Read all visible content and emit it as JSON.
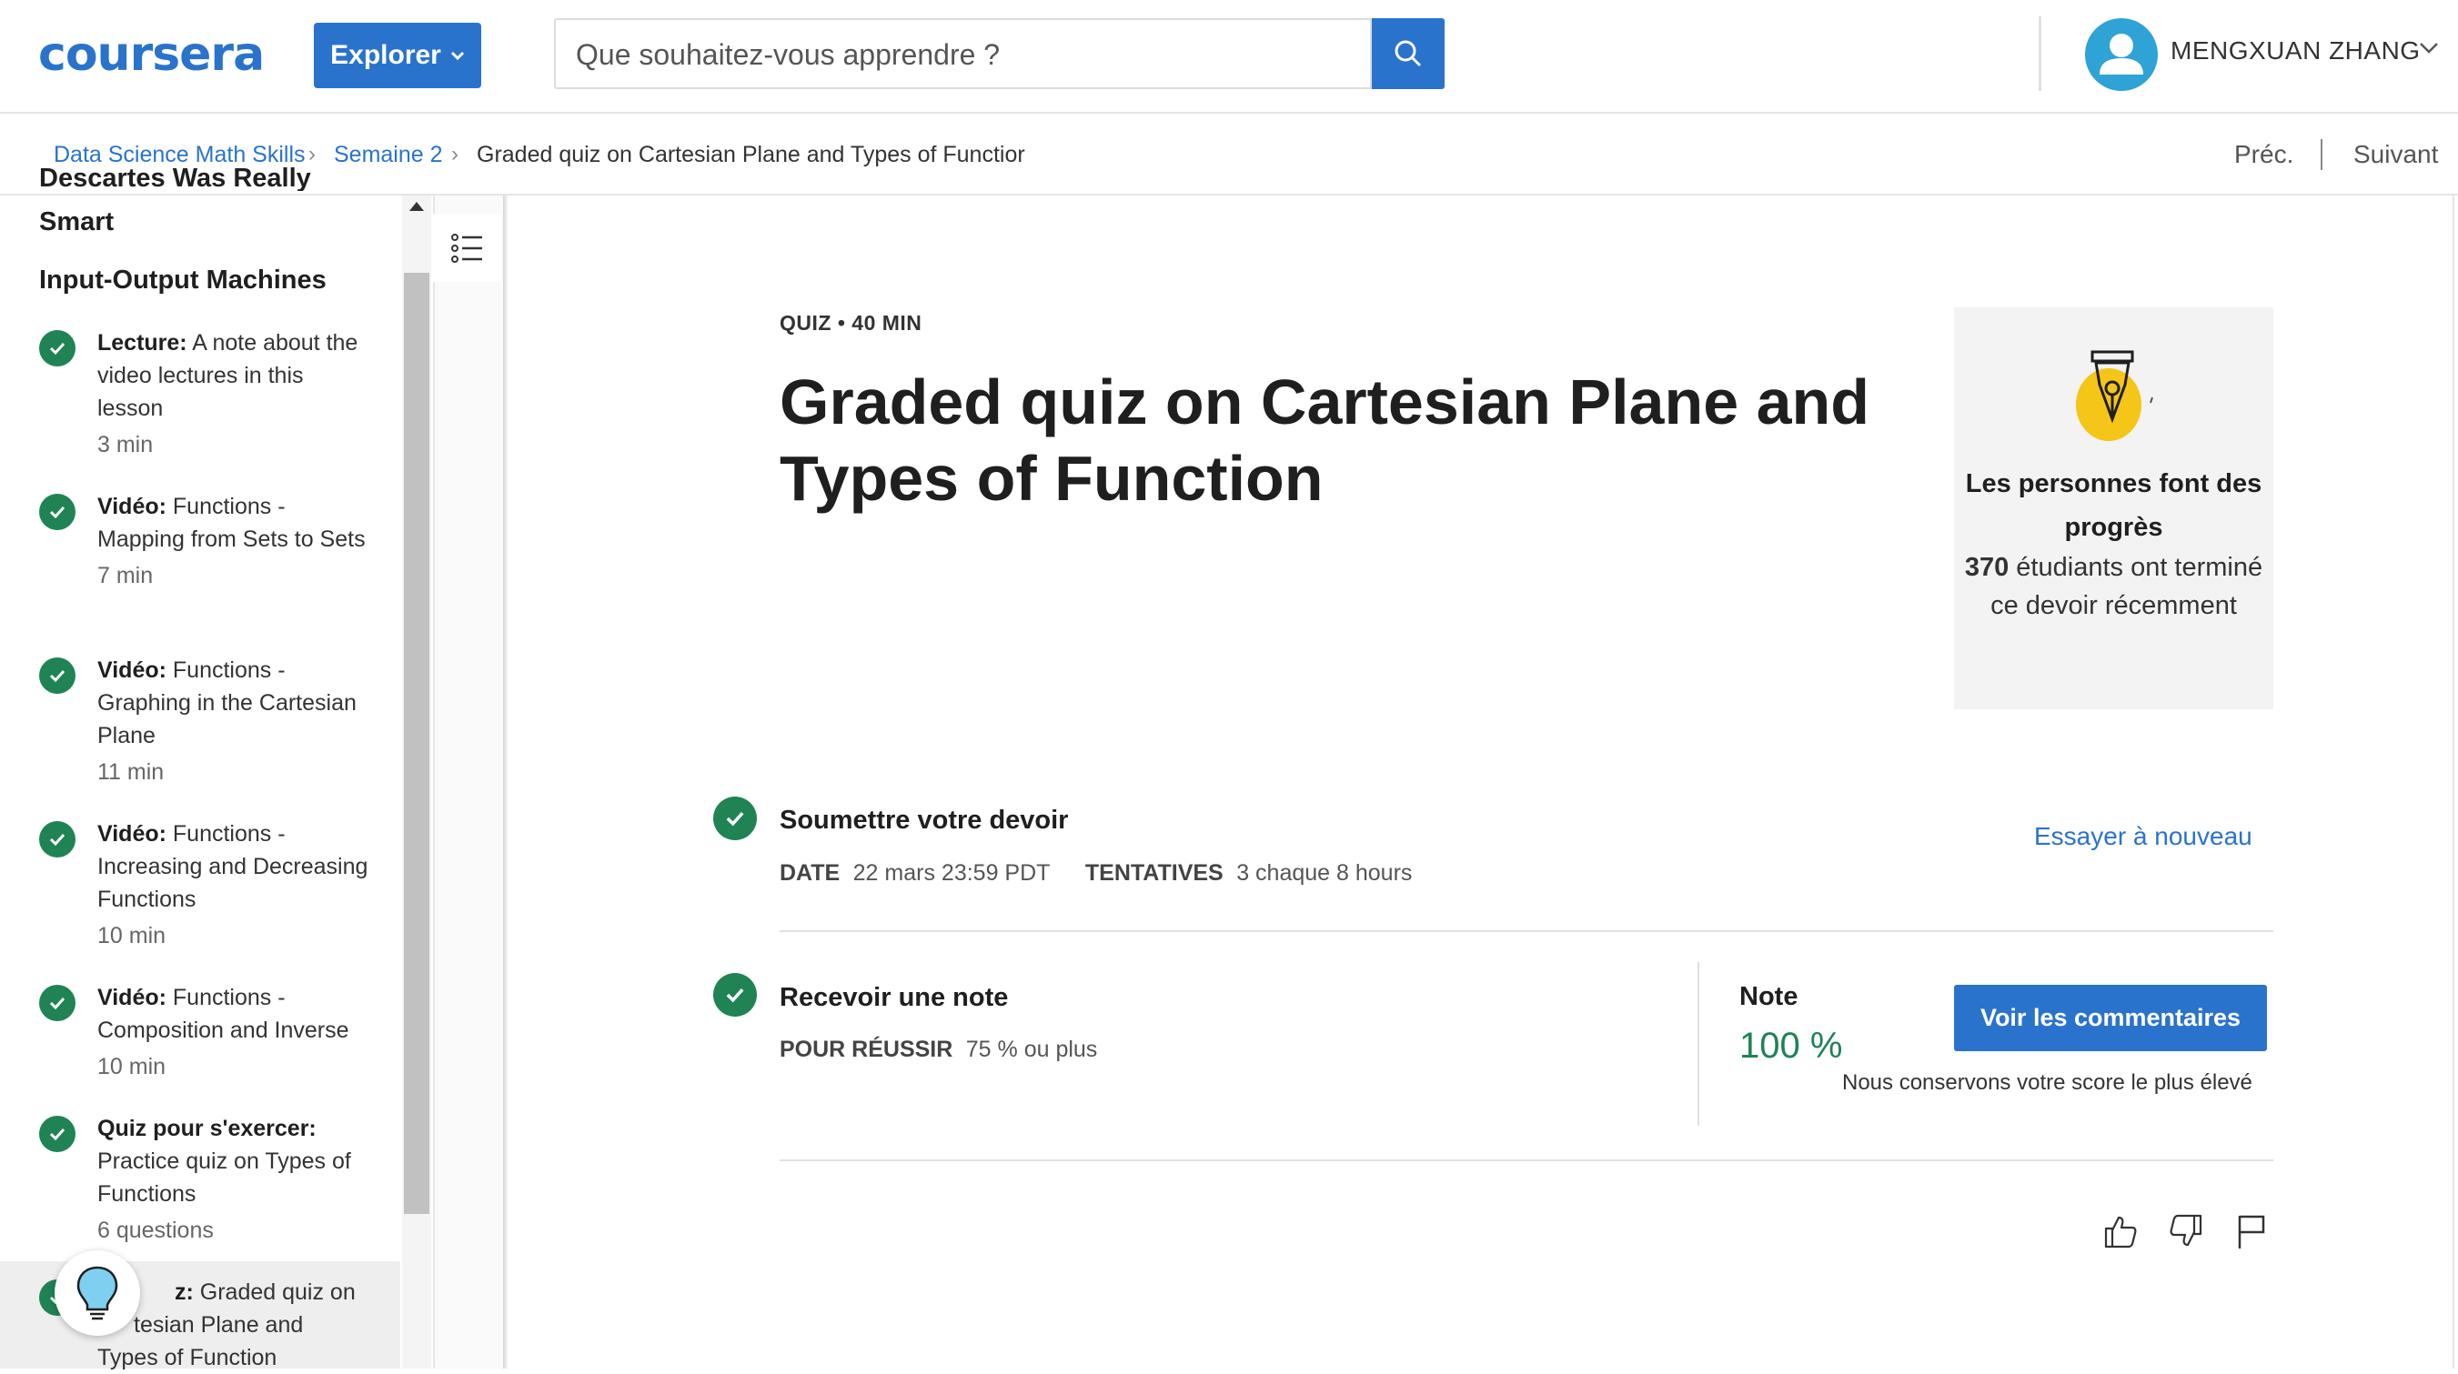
{
  "header": {
    "logo": "coursera",
    "explore_label": "Explorer",
    "search_placeholder": "Que souhaitez-vous apprendre ?",
    "user_name": "MENGXUAN ZHANG"
  },
  "breadcrumb": {
    "items": [
      "Data Science Math Skills",
      "Semaine 2",
      "Graded quiz on Cartesian Plane and Types of Functior"
    ],
    "prev": "Préc.",
    "next": "Suivant"
  },
  "sidebar": {
    "partial_title": "Descartes Was Really",
    "partial_title_2": "Smart",
    "section": "Input-Output Machines",
    "items": [
      {
        "type": "Lecture:",
        "title": "A note about the video lectures in this lesson",
        "meta": "3  min"
      },
      {
        "type": "Vidéo:",
        "title": "Functions - Mapping from Sets to Sets",
        "meta": "7  min"
      },
      {
        "type": "Vidéo:",
        "title": "Functions - Graphing in the Cartesian Plane",
        "meta": "11  min"
      },
      {
        "type": "Vidéo:",
        "title": "Functions - Increasing and Decreasing Functions",
        "meta": "10  min"
      },
      {
        "type": "Vidéo:",
        "title": "Functions - Composition and Inverse",
        "meta": "10  min"
      },
      {
        "type": "Quiz pour s'exercer:",
        "title": "Practice quiz on Types of Functions",
        "meta": "6 questions"
      },
      {
        "type": "z:",
        "title": "Graded quiz on",
        "title2": "tesian Plane and",
        "title3": "Types of Function"
      }
    ]
  },
  "main": {
    "kicker": "QUIZ • 40  MIN",
    "title": "Graded quiz on Cartesian Plane and Types of Function",
    "progress_card": {
      "heading": "Les personnes font des progrès",
      "count": "370",
      "text": " étudiants ont terminé ce devoir récemment"
    },
    "submit": {
      "title": "Soumettre votre devoir",
      "date_label": "DATE",
      "date_value": "22 mars 23:59 PDT",
      "attempts_label": "TENTATIVES",
      "attempts_value": "3 chaque 8  hours",
      "retry": "Essayer à nouveau"
    },
    "grade": {
      "title": "Recevoir une note",
      "pass_label": "POUR RÉUSSIR",
      "pass_value": "75 % ou plus",
      "note_label": "Note",
      "note_value": "100 %",
      "feedback_button": "Voir les commentaires",
      "score_note": "Nous conservons votre score le plus élevé"
    }
  },
  "colors": {
    "brand_blue": "#2a73cc",
    "success_green": "#1f8354",
    "badge_yellow": "#f5c518"
  }
}
